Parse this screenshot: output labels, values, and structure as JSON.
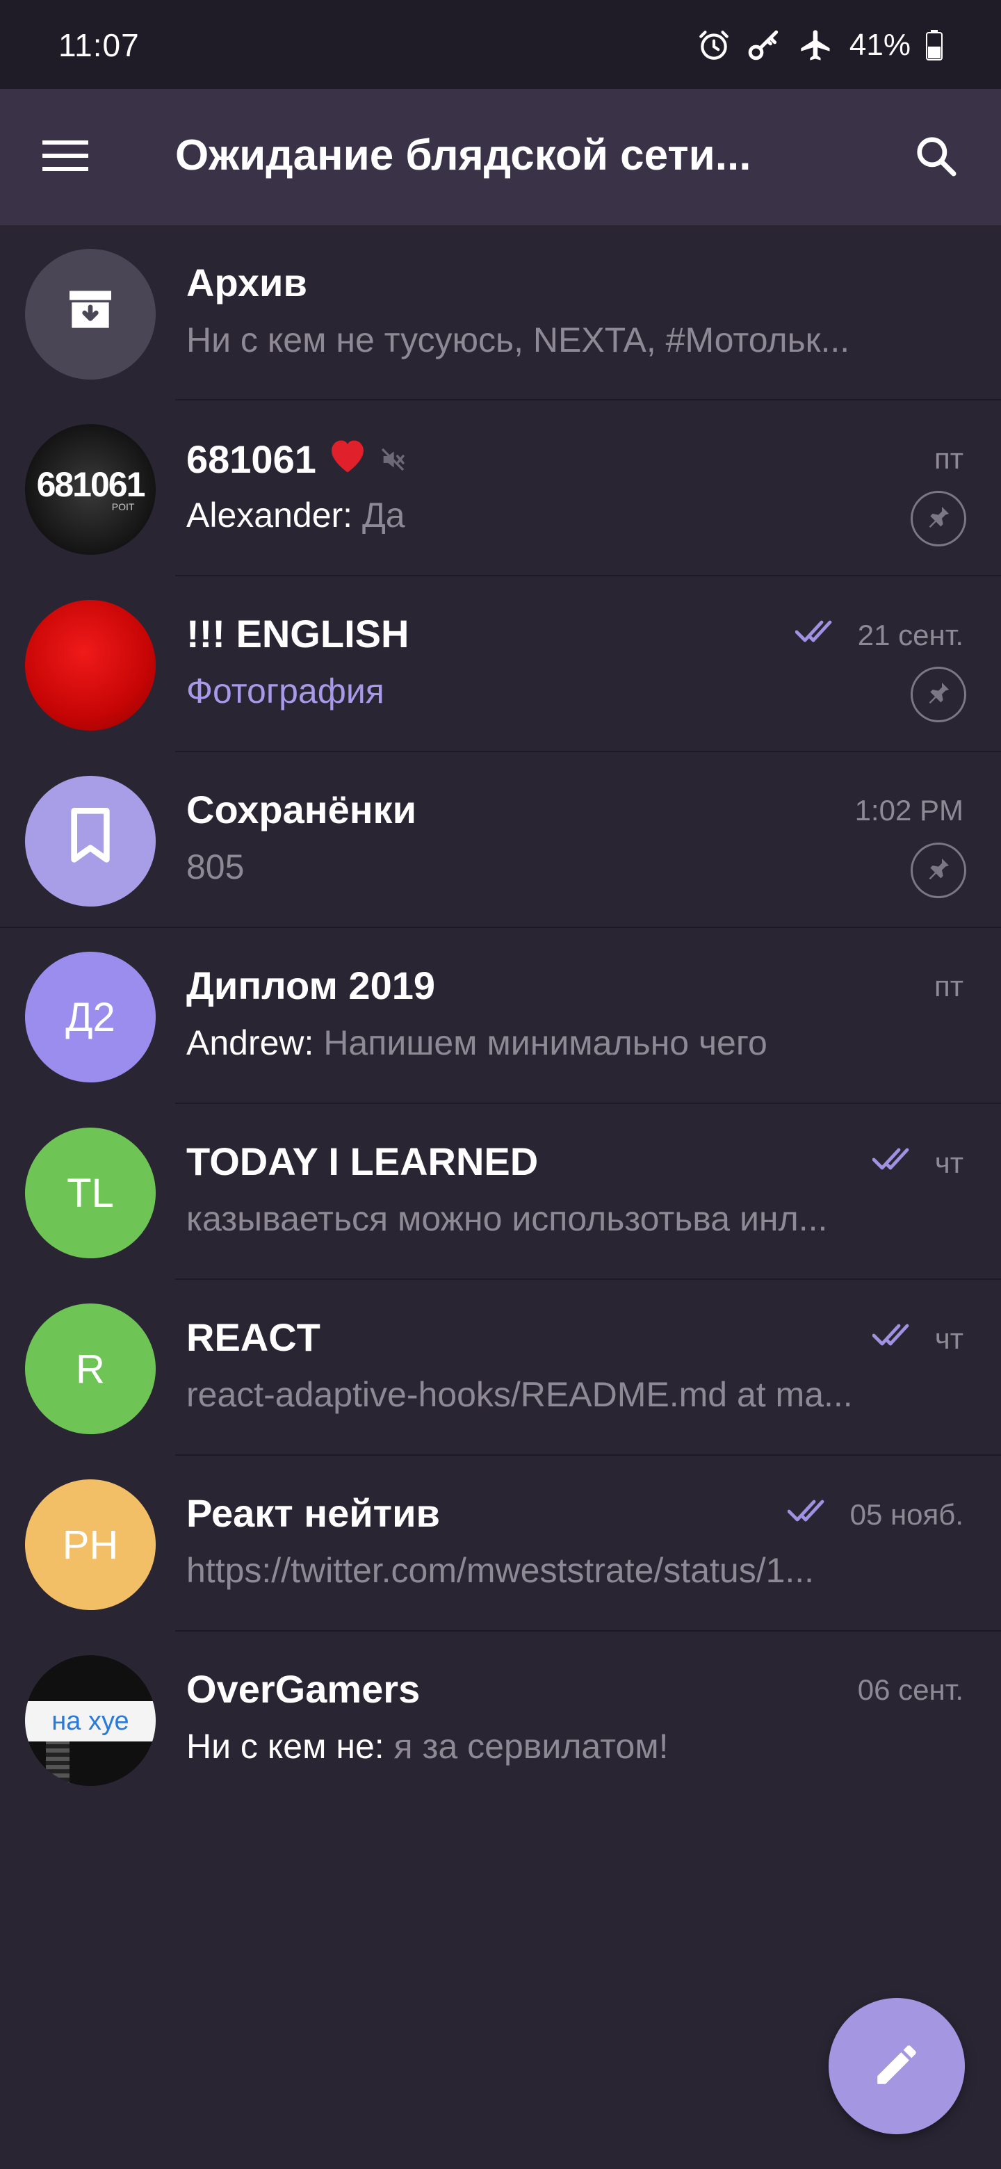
{
  "status_bar": {
    "time": "11:07",
    "battery": "41%",
    "icons": [
      "alarm-icon",
      "key-icon",
      "airplane-icon",
      "battery-icon"
    ]
  },
  "app_bar": {
    "title": "Ожидание блядской сети...",
    "menu_icon": "hamburger-menu-icon",
    "search_icon": "search-icon"
  },
  "colors": {
    "background": "#2a2533",
    "app_bar": "#3a3347",
    "accent": "#a596e2",
    "read_checks": "#9f92e0",
    "muted_text": "#8e8a95"
  },
  "chats": [
    {
      "title": "Архив",
      "preview": "Ни с кем не тусуюсь, NEXTA, #Мотольк...",
      "avatar_icon": "archive-icon",
      "avatar_color": "#4b4655"
    },
    {
      "title": "681061",
      "emoji": "❤️",
      "muted": true,
      "time": "пт",
      "sender": "Alexander: ",
      "preview": "Да",
      "pinned": true,
      "avatar_text": "681061",
      "avatar_subtext": "POIT",
      "avatar_color": "#1b1b1b"
    },
    {
      "title": "!!! ENGLISH",
      "time": "21 сент.",
      "read": true,
      "preview": "Фотография",
      "pinned": true,
      "avatar_color": "#d40a0a"
    },
    {
      "title": "Сохранёнки",
      "time": "1:02 PM",
      "preview": "805",
      "pinned": true,
      "avatar_icon": "bookmark-icon",
      "avatar_color": "#a89ee8"
    },
    {
      "title": "Диплом 2019",
      "time": "пт",
      "sender": "Andrew: ",
      "preview": "Напишем минимально чего",
      "avatar_text": "Д2",
      "avatar_color": "#9a8ded"
    },
    {
      "title": "TODAY I LEARNED",
      "time": "чт",
      "read": true,
      "preview": "казываеться можно использотьва инл...",
      "avatar_text": "TL",
      "avatar_color": "#6fc456"
    },
    {
      "title": "REACT",
      "time": "чт",
      "read": true,
      "preview": "react-adaptive-hooks/README.md at ma...",
      "avatar_text": "R",
      "avatar_color": "#6fc456"
    },
    {
      "title": "Реакт нейтив",
      "time": "05 нояб.",
      "read": true,
      "preview": "https://twitter.com/mweststrate/status/1...",
      "avatar_text": "PH",
      "avatar_color": "#f3bf66"
    },
    {
      "title": "OverGamers",
      "time": "06 сент.",
      "sender": "Ни с кем не: ",
      "preview": "я за сервилатом!",
      "avatar_text": "на хуе",
      "avatar_color": "#101010"
    }
  ],
  "fab": {
    "icon": "pencil-icon"
  }
}
